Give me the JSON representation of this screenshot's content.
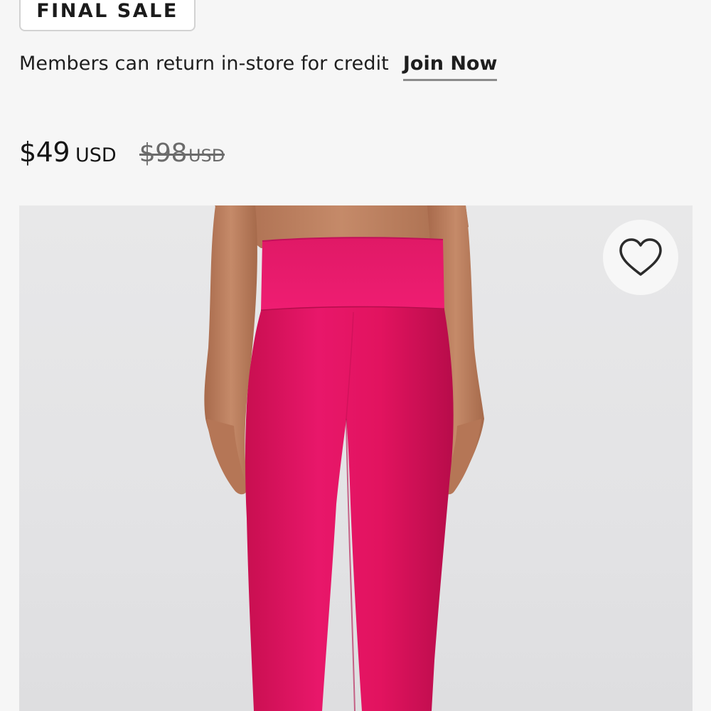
{
  "badge": {
    "label": "FINAL SALE"
  },
  "membership": {
    "message": "Members can return in-store for credit",
    "link_label": "Join Now"
  },
  "price": {
    "sale_amount": "$49",
    "sale_currency": "USD",
    "original_amount": "$98",
    "original_currency": "USD"
  },
  "product_image": {
    "subject": "pink high-rise leggings"
  },
  "wishlist": {
    "icon": "heart-outline-icon"
  },
  "colors": {
    "background": "#f6f6f6",
    "text": "#1b1b1b",
    "strikethrough_text": "#6b6b6b",
    "link_underline": "#8b8b8b",
    "product": "#e0145c",
    "skin": "#b97d5d"
  }
}
